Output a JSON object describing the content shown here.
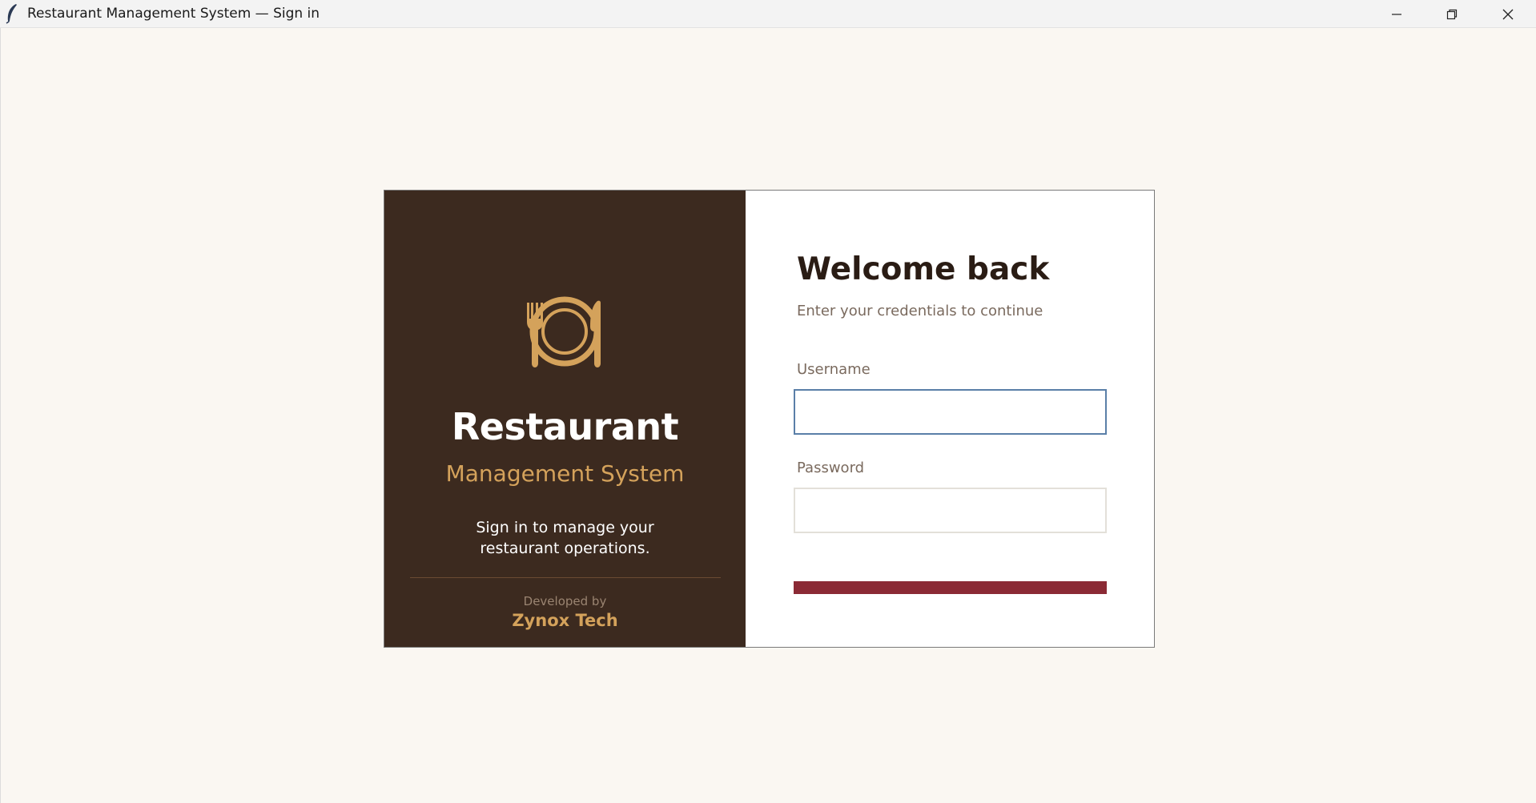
{
  "window": {
    "title": "Restaurant Management System — Sign in",
    "icon": "feather-icon",
    "controls": [
      "minimize-icon",
      "restore-icon",
      "close-icon"
    ]
  },
  "brand": {
    "logo_icon": "plate-fork-knife-icon",
    "title": "Restaurant",
    "subtitle": "Management System",
    "tagline": "Sign in to manage your restaurant operations.",
    "developed_by_label": "Developed by",
    "developer_name": "Zynox Tech"
  },
  "form": {
    "heading": "Welcome back",
    "subheading": "Enter your credentials to continue",
    "username_label": "Username",
    "username_value": "",
    "password_label": "Password",
    "password_value": "",
    "signin_label": ""
  },
  "colors": {
    "brand_panel_bg": "#3c2a1f",
    "accent_gold": "#d4a25b",
    "button_red": "#8b2a35",
    "focus_blue": "#5a7fa8",
    "page_bg": "#faf7f2"
  }
}
